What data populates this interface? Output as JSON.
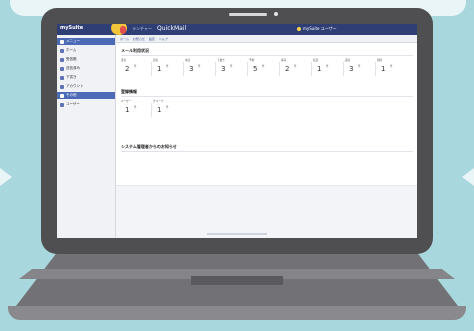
{
  "app": {
    "brand": "mySuite",
    "subtitle": "ランチャー",
    "service_name": "QuickMail",
    "header_right": "mySuite ユーザー"
  },
  "tabs": [
    {
      "label": "ホーム"
    },
    {
      "label": "お知らせ"
    },
    {
      "label": "設定"
    },
    {
      "label": "ヘルプ"
    }
  ],
  "sidebar": {
    "items": [
      {
        "label": "メニュー",
        "highlight": true
      },
      {
        "label": "ホーム",
        "highlight": false
      },
      {
        "label": "受信箱",
        "highlight": false
      },
      {
        "label": "送信済み",
        "highlight": false
      },
      {
        "label": "下書き",
        "highlight": false
      },
      {
        "label": "アカウント",
        "highlight": false
      },
      {
        "label": "その他",
        "highlight": true
      },
      {
        "label": "ユーザー",
        "highlight": false
      }
    ]
  },
  "sections": [
    {
      "title": "メール利用状況",
      "metrics": [
        {
          "label": "受信",
          "value": "2",
          "unit": "件"
        },
        {
          "label": "送信",
          "value": "1",
          "unit": "件"
        },
        {
          "label": "未読",
          "value": "3",
          "unit": "件"
        },
        {
          "label": "下書き",
          "value": "3",
          "unit": "件"
        },
        {
          "label": "予約",
          "value": "5",
          "unit": "件"
        },
        {
          "label": "保存",
          "value": "2",
          "unit": "件"
        },
        {
          "label": "転送",
          "value": "1",
          "unit": "件"
        },
        {
          "label": "返信",
          "value": "3",
          "unit": "件"
        },
        {
          "label": "削除",
          "value": "1",
          "unit": "件"
        }
      ]
    },
    {
      "title": "登録情報",
      "metrics": [
        {
          "label": "ユーザー",
          "value": "1",
          "unit": "件"
        },
        {
          "label": "グループ",
          "value": "1",
          "unit": "件"
        }
      ]
    },
    {
      "title": "システム管理者からのお知らせ",
      "metrics": []
    }
  ],
  "colors": {
    "background": "#a9d7de",
    "laptop_bezel": "#4f4f51",
    "app_header": "#2f3f75",
    "sidebar_highlight": "#4c6ab5"
  }
}
